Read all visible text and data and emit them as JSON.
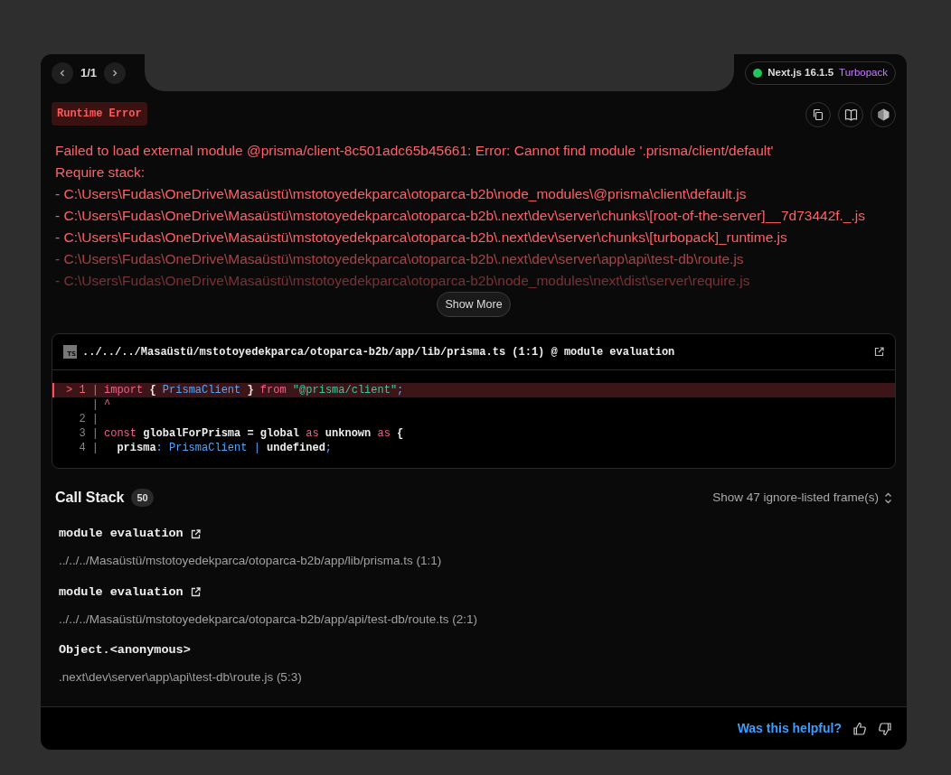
{
  "pagination": {
    "label": "1/1"
  },
  "version_badge": {
    "name": "Next.js 16.1.5",
    "bundler": "Turbopack"
  },
  "error_type": "Runtime Error",
  "message": {
    "expanded": false,
    "lines": [
      "Failed to load external module @prisma/client-8c501adc65b45661: Error: Cannot find module '.prisma/client/default'",
      "Require stack:",
      "- C:\\Users\\Fudas\\OneDrive\\Masaüstü\\mstotoyedekparca\\otoparca-b2b\\node_modules\\@prisma\\client\\default.js",
      "- C:\\Users\\Fudas\\OneDrive\\Masaüstü\\mstotoyedekparca\\otoparca-b2b\\.next\\dev\\server\\chunks\\[root-of-the-server]__7d73442f._.js",
      "- C:\\Users\\Fudas\\OneDrive\\Masaüstü\\mstotoyedekparca\\otoparca-b2b\\.next\\dev\\server\\chunks\\[turbopack]_runtime.js",
      "- C:\\Users\\Fudas\\OneDrive\\Masaüstü\\mstotoyedekparca\\otoparca-b2b\\.next\\dev\\server\\app\\api\\test-db\\route.js",
      "- C:\\Users\\Fudas\\OneDrive\\Masaüstü\\mstotoyedekparca\\otoparca-b2b\\node_modules\\next\\dist\\server\\require.js"
    ],
    "toggle": "Show More"
  },
  "code_frame": {
    "file_icon_label": "TS",
    "file": "../../../Masaüstü/mstotoyedekparca/otoparca-b2b/app/lib/prisma.ts (1:1) @ module evaluation",
    "lines": [
      {
        "gutter": "> 1 |",
        "highlighted": true,
        "tokens": [
          {
            "kind": "keyword",
            "text": "import"
          },
          {
            "kind": "plain",
            "text": " { "
          },
          {
            "kind": "type",
            "text": "PrismaClient"
          },
          {
            "kind": "plain",
            "text": " } "
          },
          {
            "kind": "keyword",
            "text": "from"
          },
          {
            "kind": "string",
            "text": " \"@prisma/client\""
          },
          {
            "kind": "punct",
            "text": ";"
          }
        ]
      },
      {
        "gutter": "|",
        "highlighted": false,
        "tokens": [
          {
            "kind": "keyword",
            "text": "^"
          }
        ]
      },
      {
        "gutter": "2 |",
        "highlighted": false
      },
      {
        "gutter": "3 |",
        "highlighted": false,
        "tokens": [
          {
            "kind": "keyword",
            "text": "const"
          },
          {
            "kind": "plain",
            "text": " globalForPrisma = global "
          },
          {
            "kind": "keyword",
            "text": "as"
          },
          {
            "kind": "plain",
            "text": " unknown "
          },
          {
            "kind": "keyword",
            "text": "as"
          },
          {
            "kind": "plain",
            "text": " {"
          }
        ]
      },
      {
        "gutter": "4 |",
        "highlighted": false,
        "tokens": [
          {
            "kind": "plain",
            "text": "  prisma"
          },
          {
            "kind": "punct",
            "text": ":"
          },
          {
            "kind": "type",
            "text": " PrismaClient"
          },
          {
            "kind": "punct",
            "text": " | "
          },
          {
            "kind": "plain",
            "text": "undefined"
          },
          {
            "kind": "punct",
            "text": ";"
          }
        ]
      }
    ]
  },
  "call_stack": {
    "title": "Call Stack",
    "count": "50",
    "ignore_toggle": "Show 47 ignore-listed frame(s)",
    "frames": [
      {
        "name": "module evaluation",
        "location": "../../../Masaüstü/mstotoyedekparca/otoparca-b2b/app/lib/prisma.ts (1:1)",
        "external_link": true
      },
      {
        "name": "module evaluation",
        "location": "../../../Masaüstü/mstotoyedekparca/otoparca-b2b/app/api/test-db/route.ts (2:1)",
        "external_link": true
      },
      {
        "name": "Object.<anonymous>",
        "location": ".next\\dev\\server\\app\\api\\test-db\\route.js (5:3)",
        "external_link": false
      }
    ]
  },
  "footer": {
    "feedback_prompt": "Was this helpful?"
  }
}
